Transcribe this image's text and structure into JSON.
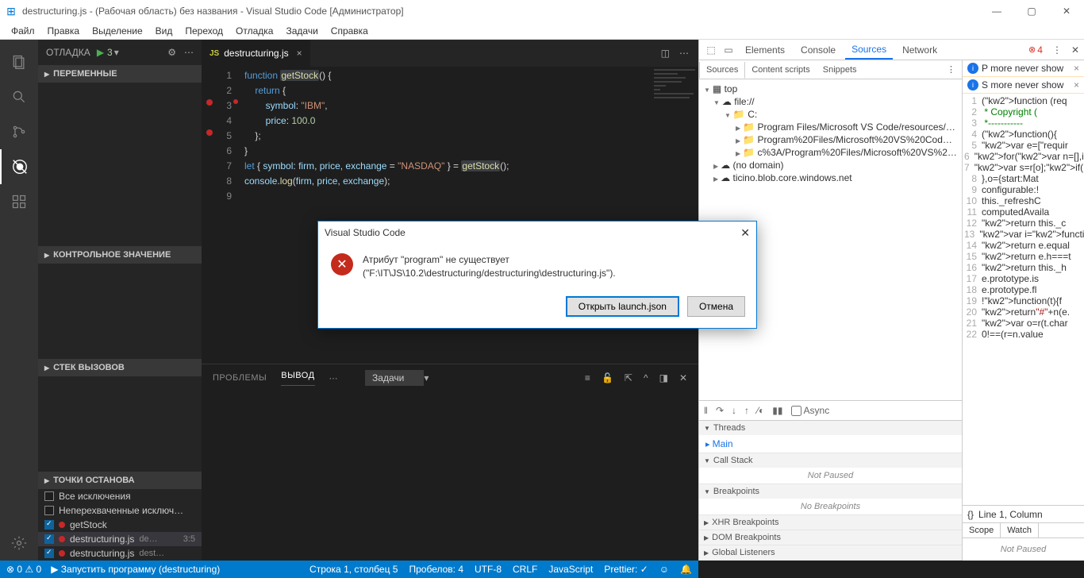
{
  "title": "destructuring.js - (Рабочая область) без названия - Visual Studio Code [Администратор]",
  "menu": [
    "Файл",
    "Правка",
    "Выделение",
    "Вид",
    "Переход",
    "Отладка",
    "Задачи",
    "Справка"
  ],
  "sidebar": {
    "title": "ОТЛАДКА",
    "config_num": "3",
    "sections": {
      "vars": "ПЕРЕМЕННЫЕ",
      "watch": "КОНТРОЛЬНОЕ ЗНАЧЕНИЕ",
      "callstack": "СТЕК ВЫЗОВОВ",
      "breakpoints": "ТОЧКИ ОСТАНОВА"
    },
    "bp": {
      "all_ex": "Все исключения",
      "uncaught": "Неперехваченные исключ…",
      "getstock": "getStock",
      "file1": "destructuring.js",
      "file1_sub": "de…",
      "file1_pos": "3:5",
      "file2": "destructuring.js",
      "file2_sub": "dest…"
    }
  },
  "tab": {
    "label": "destructuring.js"
  },
  "code_lines": [
    "1",
    "2",
    "3",
    "4",
    "5",
    "6",
    "7",
    "8",
    "9"
  ],
  "panel": {
    "problems": "ПРОБЛЕМЫ",
    "output": "ВЫВОД",
    "select": "Задачи"
  },
  "devtools": {
    "tabs": [
      "Elements",
      "Console",
      "Sources",
      "Network"
    ],
    "err_count": "4",
    "subtabs": [
      "Sources",
      "Content scripts",
      "Snippets"
    ],
    "tree": {
      "top": "top",
      "file": "file://",
      "c": "C:",
      "p1": "Program Files/Microsoft VS Code/resources/app/…",
      "p2": "Program%20Files/Microsoft%20VS%20Code/reso…",
      "p3": "c%3A/Program%20Files/Microsoft%20VS%20Code/…",
      "nodomain": "(no domain)",
      "blob": "ticino.blob.core.windows.net"
    },
    "msgs": {
      "m1": "P more  never show",
      "m2": "S more  never show"
    },
    "src": [
      "(function (req",
      " * Copyright (",
      " *-----------",
      "(function(){",
      "var e=[\"requir",
      "for(var n=[],i",
      "var s=r[o];if(",
      "},o={start:Mat",
      "configurable:!",
      "this._refreshC",
      "computedAvaila",
      "return this._c",
      "var i=function",
      "return e.equal",
      "return e.h===t",
      "return this._h",
      "e.prototype.is",
      "e.prototype.fl",
      "!function(t){f",
      "return\"#\"+n(e.",
      "var o=r(t.char",
      "0!==(r=n.value"
    ],
    "cursor": "Line 1, Column",
    "async": "Async",
    "threads": "Threads",
    "main": "Main",
    "callstack_h": "Call Stack",
    "notpaused": "Not Paused",
    "breakpoints_h": "Breakpoints",
    "nobreak": "No Breakpoints",
    "xhr": "XHR Breakpoints",
    "dom": "DOM Breakpoints",
    "global": "Global Listeners",
    "scope": "Scope",
    "watch": "Watch",
    "scope_np": "Not Paused"
  },
  "status": {
    "errors": "0",
    "warnings": "0",
    "launch": "Запустить программу (destructuring)",
    "pos": "Строка 1, столбец 5",
    "spaces": "Пробелов: 4",
    "enc": "UTF-8",
    "eol": "CRLF",
    "lang": "JavaScript",
    "prettier": "Prettier: ✓"
  },
  "dialog": {
    "title": "Visual Studio Code",
    "line1": "Атрибут \"program\" не существует",
    "line2": "(\"F:\\IT\\JS\\10.2\\destructuring/destructuring\\destructuring.js\").",
    "open": "Открыть launch.json",
    "cancel": "Отмена"
  }
}
